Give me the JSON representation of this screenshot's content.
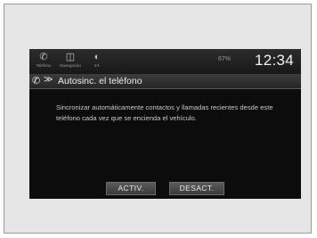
{
  "statusbar": {
    "items": [
      {
        "icon": "phone-icon",
        "label": "Teléfono"
      },
      {
        "icon": "navigation-icon",
        "label": "Navegación"
      },
      {
        "icon": "info-icon",
        "label": "Inf."
      }
    ],
    "signal": "67%",
    "time": "12:34"
  },
  "titlebar": {
    "icon": "phone-icon",
    "chevron": "≫",
    "title": "Autosinc. el teléfono"
  },
  "message": "Sincronizar automáticamente contactos y llamadas recientes desde este teléfono cada vez que se encienda el vehículo.",
  "buttons": {
    "activ": "ACTIV.",
    "desact": "DESACT."
  }
}
